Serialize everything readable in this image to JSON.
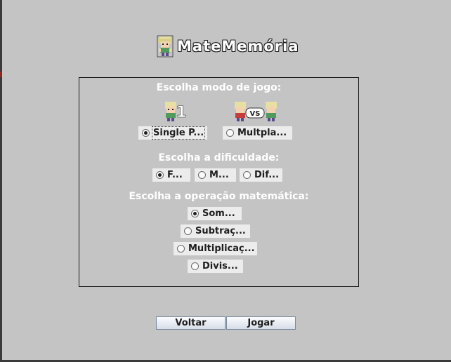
{
  "app": {
    "title": "MateMemória"
  },
  "mode": {
    "heading": "Escolha modo de jogo:",
    "single_label": "Single P...",
    "multi_label": "Multpla...",
    "single_icon_text": "1",
    "vs_text": "VS",
    "selected": "single"
  },
  "difficulty": {
    "heading": "Escolha a dificuldade:",
    "options": [
      "F...",
      "M...",
      "Dif..."
    ],
    "selected_index": 0
  },
  "operation": {
    "heading": "Escolha a operação matemática:",
    "options": [
      "Som...",
      "Subtraç...",
      "Multiplicaç...",
      "Divis..."
    ],
    "selected_index": 0
  },
  "buttons": {
    "back": "Voltar",
    "play": "Jogar"
  },
  "icons": {
    "title": "character-sprite-icon",
    "single": "single-player-icon",
    "multi": "multiplayer-vs-icon"
  },
  "colors": {
    "background": "#c4c4c4",
    "heading_text": "#ffffff",
    "button_border": "#7a8aa0"
  }
}
